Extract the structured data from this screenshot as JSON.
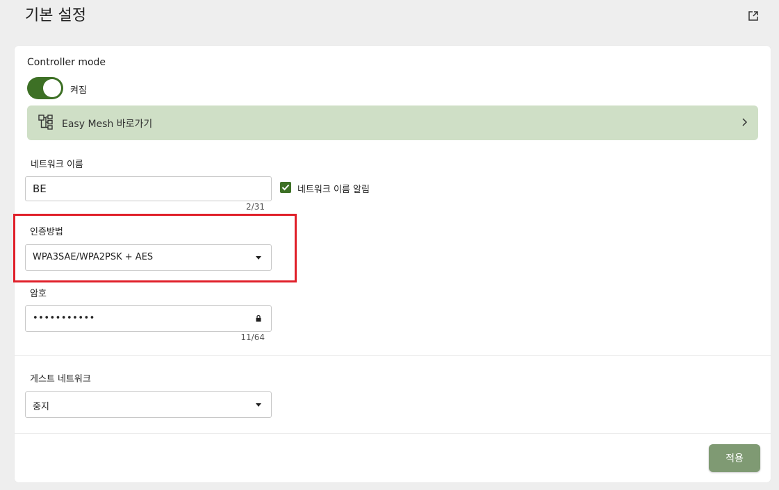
{
  "header": {
    "title": "기본 설정",
    "export_icon": "export-icon"
  },
  "controller": {
    "label": "Controller mode",
    "toggle_state": "켜짐",
    "toggle_on": true
  },
  "easymesh": {
    "icon": "mesh-topology-icon",
    "label": "Easy Mesh 바로가기",
    "chevron_icon": "chevron-right-icon"
  },
  "network_name": {
    "label": "네트워크 이름",
    "value": "BE",
    "counter": "2/31",
    "broadcast_label": "네트워크 이름 알림",
    "broadcast_checked": true
  },
  "auth": {
    "label": "인증방법",
    "value": "WPA3SAE/WPA2PSK + AES"
  },
  "password": {
    "label": "암호",
    "value": "•••••••••••",
    "counter": "11/64",
    "lock_icon": "lock-icon"
  },
  "guest": {
    "label": "게스트 네트워크",
    "value": "중지"
  },
  "actions": {
    "apply_label": "적용"
  },
  "colors": {
    "accent": "#3d7025",
    "easymesh_bg": "#cfdfc6",
    "apply_bg": "#7f9a73",
    "highlight": "#e0202a"
  }
}
